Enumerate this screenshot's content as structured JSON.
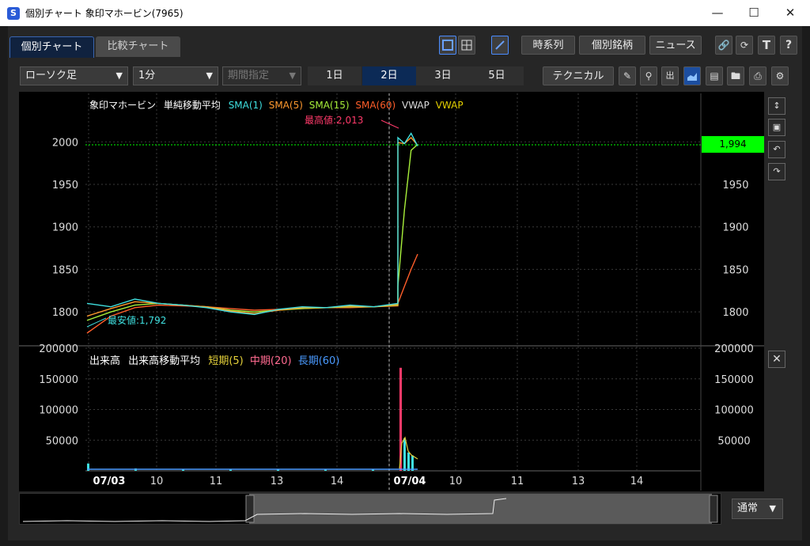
{
  "window": {
    "title": "個別チャート 象印マホービン(7965)"
  },
  "tabs": [
    {
      "label": "個別チャート"
    },
    {
      "label": "比較チャート"
    }
  ],
  "toolbar": {
    "jikeiretsu": "時系列",
    "kobetsu": "個別銘柄",
    "news": "ニュース"
  },
  "controls": {
    "chart_type": "ローソク足",
    "interval": "1分",
    "period": "期間指定",
    "technical": "テクニカル",
    "days": [
      "1日",
      "2日",
      "3日",
      "5日"
    ],
    "active_day": 1
  },
  "legend_price": {
    "name": "象印マホービン",
    "indicator": "単純移動平均",
    "sma1": "SMA(1)",
    "sma5": "SMA(5)",
    "sma15": "SMA(15)",
    "sma60": "SMA(60)",
    "vwap1": "VWAP",
    "vwap2": "VWAP"
  },
  "legend_volume": {
    "name": "出来高",
    "indicator": "出来高移動平均",
    "short": "短期(5)",
    "mid": "中期(20)",
    "long": "長期(60)"
  },
  "annotations": {
    "high": "最高値:2,013",
    "low": "最安値:1,792"
  },
  "current_price": "1,994",
  "nav": {
    "mode": "通常"
  },
  "colors": {
    "sma1": "#3fe0e0",
    "sma5": "#ff9a2e",
    "sma15": "#a8f03a",
    "sma60": "#ff5e2a",
    "vwap1": "#dcdcdc",
    "vwap2": "#e4d000",
    "price_tag": "#00ff00",
    "short": "#e6d23a",
    "mid": "#ff6a90",
    "long": "#4a9aff"
  },
  "chart_data": {
    "type": "line",
    "price_axis": {
      "ylim": [
        1762,
        2057
      ],
      "ticks": [
        1800,
        1850,
        1900,
        1950,
        2000
      ]
    },
    "volume_axis": {
      "ylim": [
        0,
        200000
      ],
      "ticks": [
        50000,
        100000,
        150000,
        200000
      ]
    },
    "x_labels": [
      "07/03",
      "10",
      "11",
      "13",
      "14",
      "07/04",
      "10",
      "11",
      "13",
      "14"
    ],
    "series": [
      {
        "name": "SMA(1)",
        "values": [
          1810,
          1806,
          1815,
          1810,
          1808,
          1805,
          1800,
          1797,
          1803,
          1806,
          1805,
          1808,
          1806,
          1810,
          2005,
          1998,
          2010,
          1995
        ]
      },
      {
        "name": "SMA(5)",
        "values": [
          1795,
          1804,
          1812,
          1810,
          1808,
          1806,
          1801,
          1798,
          1802,
          1805,
          1805,
          1807,
          1806,
          1809,
          1999,
          1998,
          2005,
          1996
        ]
      },
      {
        "name": "SMA(15)",
        "values": [
          1790,
          1800,
          1808,
          1810,
          1808,
          1806,
          1802,
          1800,
          1802,
          1804,
          1805,
          1806,
          1806,
          1808,
          1830,
          1920,
          1990,
          1997
        ]
      },
      {
        "name": "SMA(60)",
        "values": [
          1775,
          1795,
          1805,
          1808,
          1807,
          1806,
          1804,
          1802,
          1803,
          1804,
          1805,
          1805,
          1806,
          1807,
          1810,
          1830,
          1850,
          1868
        ]
      }
    ],
    "volume_peaks": [
      12000,
      4000,
      3000,
      2500,
      2000,
      2500,
      3000,
      168000,
      53000,
      30000,
      25000
    ]
  }
}
